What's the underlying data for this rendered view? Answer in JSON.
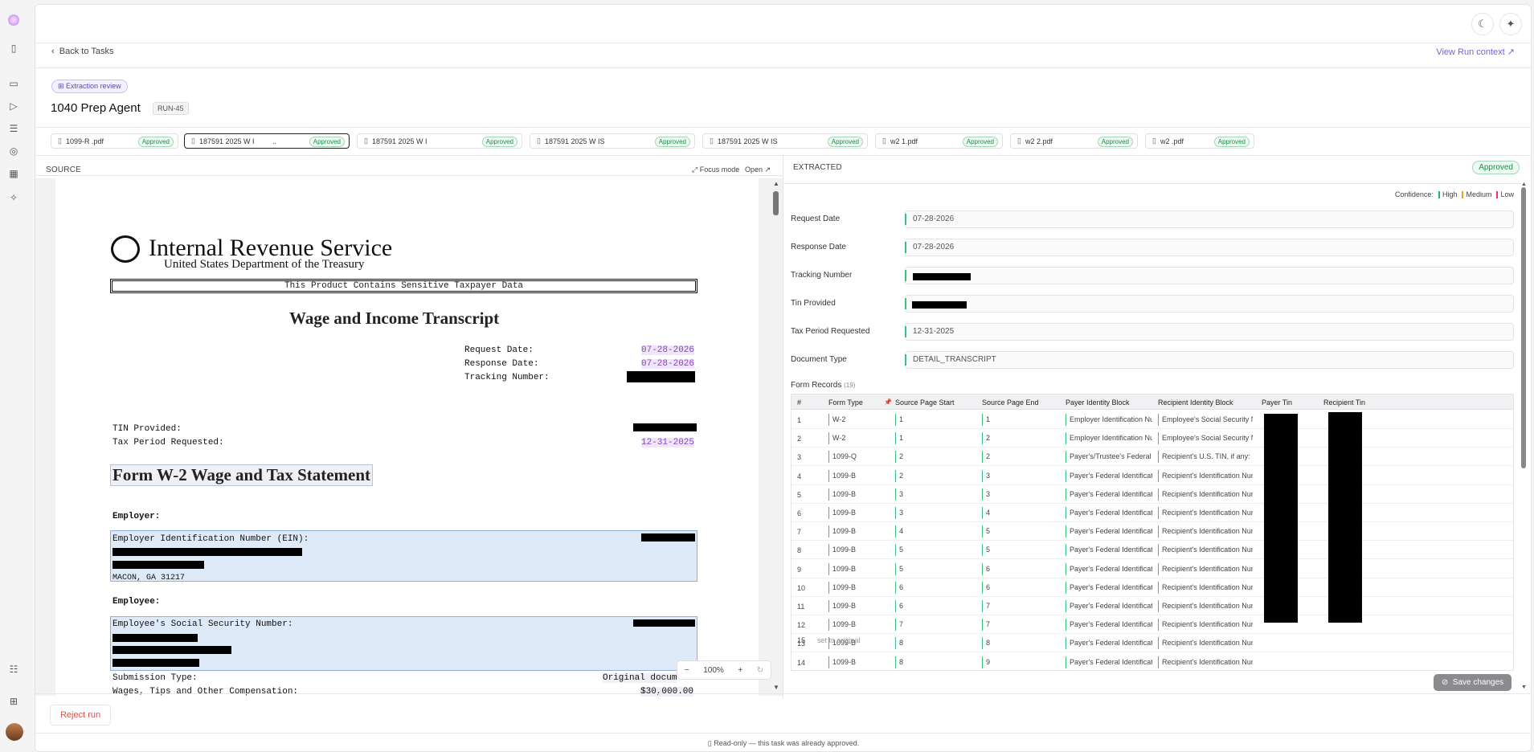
{
  "nav": {
    "back_label": "Back to Tasks",
    "run_context_label": "View Run context ↗"
  },
  "header": {
    "badge": "Extraction review",
    "title": "1040 Prep Agent",
    "run_id": "RUN-45"
  },
  "tabs": [
    {
      "name": "1099-R          .pdf",
      "status": "Approved"
    },
    {
      "name": "187591 2025 W I",
      "status": "Approved"
    },
    {
      "name": "187591 2025 W I",
      "status": "Approved"
    },
    {
      "name": "187591 2025 W IS",
      "status": "Approved"
    },
    {
      "name": "187591 2025 W IS",
      "status": "Approved"
    },
    {
      "name": "w2          1.pdf",
      "status": "Approved"
    },
    {
      "name": "w2          2.pdf",
      "status": "Approved"
    },
    {
      "name": "w2          .pdf",
      "status": "Approved"
    }
  ],
  "source": {
    "heading": "SOURCE",
    "focus_mode": "Focus mode",
    "open": "Open ↗",
    "doc": {
      "irs_title": "Internal Revenue Service",
      "irs_subtitle": "United States Department of the Treasury",
      "sensitive": "This Product Contains Sensitive Taxpayer Data",
      "transcript_title": "Wage and Income Transcript",
      "request_date_label": "Request Date:",
      "request_date": "07-28-2026",
      "response_date_label": "Response Date:",
      "response_date": "07-28-2026",
      "tracking_label": "Tracking Number:",
      "tin_label": "TIN Provided:",
      "tax_period_label": "Tax Period Requested:",
      "tax_period": "12-31-2025",
      "w2_title": "Form W-2 Wage and Tax Statement",
      "employer_label": "Employer:",
      "ein_label": "Employer Identification Number (EIN):",
      "employer_city": "MACON, GA 31217",
      "employee_label": "Employee:",
      "ssn_label": "Employee's Social Security Number:",
      "submission_label": "Submission Type:",
      "submission_value": "Original docum",
      "wages_label": "Wages, Tips and Other Compensation:",
      "wages_value": "$30,000.00"
    },
    "zoom": "100%"
  },
  "extracted": {
    "heading": "EXTRACTED",
    "status": "Approved",
    "confidence_label": "Confidence:",
    "high": "High",
    "medium": "Medium",
    "low": "Low",
    "fields": [
      {
        "label": "Request Date",
        "value": "07-28-2026"
      },
      {
        "label": "Response Date",
        "value": "07-28-2026"
      },
      {
        "label": "Tracking Number",
        "value": ""
      },
      {
        "label": "Tin Provided",
        "value": ""
      },
      {
        "label": "Tax Period Requested",
        "value": "12-31-2025"
      },
      {
        "label": "Document Type",
        "value": "DETAIL_TRANSCRIPT"
      }
    ],
    "form_records_label": "Form Records",
    "form_records_count": "(19)",
    "columns": [
      "#",
      "Form Type",
      "Source Page Start",
      "Source Page End",
      "Payer Identity Block",
      "Recipient Identity Block",
      "Payer Tin",
      "Recipient Tin"
    ],
    "rows": [
      [
        "1",
        "W-2",
        "1",
        "1",
        "Employer Identification Numb",
        "Employee's Social Security Numb"
      ],
      [
        "2",
        "W-2",
        "1",
        "2",
        "Employer Identification Numb",
        "Employee's Social Security Numb"
      ],
      [
        "3",
        "1099-Q",
        "2",
        "2",
        "Payer's/Trustee's Federal ID N",
        "Recipient's U.S. TIN, if any:"
      ],
      [
        "4",
        "1099-B",
        "2",
        "3",
        "Payer's Federal Identification",
        "Recipient's Identification Number"
      ],
      [
        "5",
        "1099-B",
        "3",
        "3",
        "Payer's Federal Identification",
        "Recipient's Identification Number"
      ],
      [
        "6",
        "1099-B",
        "3",
        "4",
        "Payer's Federal Identification",
        "Recipient's Identification Number"
      ],
      [
        "7",
        "1099-B",
        "4",
        "5",
        "Payer's Federal Identification",
        "Recipient's Identification Number"
      ],
      [
        "8",
        "1099-B",
        "5",
        "5",
        "Payer's Federal Identification",
        "Recipient's Identification Number"
      ],
      [
        "9",
        "1099-B",
        "5",
        "6",
        "Payer's Federal Identification",
        "Recipient's Identification Number"
      ],
      [
        "10",
        "1099-B",
        "6",
        "6",
        "Payer's Federal Identification",
        "Recipient's Identification Number"
      ],
      [
        "11",
        "1099-B",
        "6",
        "7",
        "Payer's Federal Identification",
        "Recipient's Identification Number"
      ],
      [
        "12",
        "1099-B",
        "7",
        "7",
        "Payer's Federal Identification",
        "Recipient's Identification Number"
      ],
      [
        "13",
        "1099-B",
        "8",
        "8",
        "Payer's Federal Identification",
        "Recipient's Identification Number"
      ],
      [
        "14",
        "1099-B",
        "8",
        "9",
        "Payer's Federal Identification",
        "Recipient's Identification Number"
      ]
    ],
    "row15_num": "15",
    "reset_label": "set to original",
    "save_label": "Save changes"
  },
  "footer": {
    "reject": "Reject run",
    "readonly": "Read-only — this task was already approved."
  }
}
